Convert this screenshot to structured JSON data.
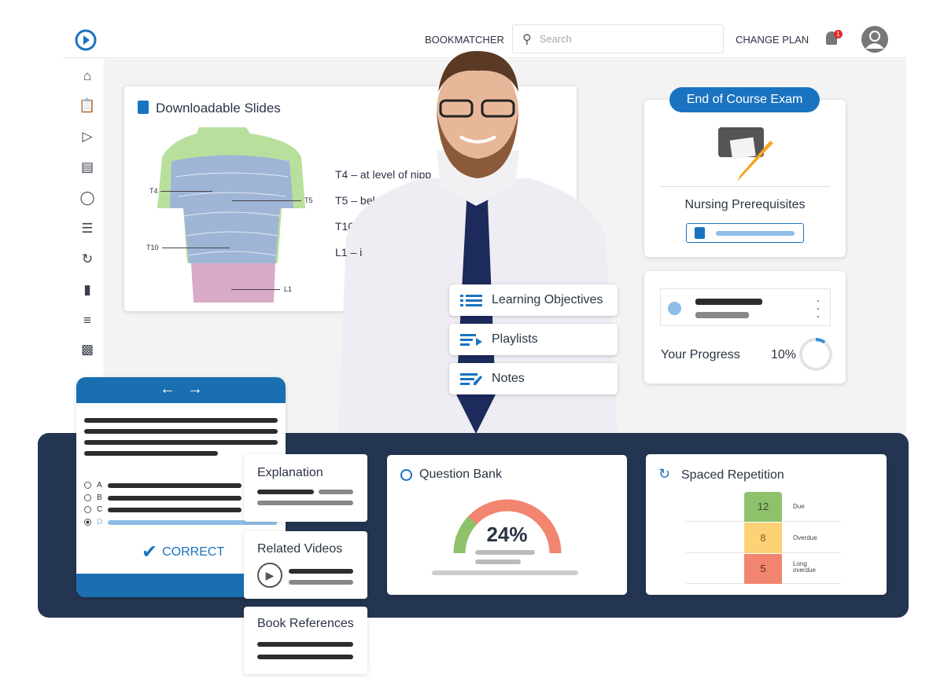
{
  "header": {
    "bookmatcher": "BOOKMATCHER",
    "search_placeholder": "Search",
    "change_plan": "CHANGE PLAN",
    "notification_count": "1"
  },
  "sidebar": {
    "icons": [
      "home-icon",
      "clipboard-icon",
      "video-icon",
      "library-icon",
      "qbank-icon",
      "list-icon",
      "repetition-icon",
      "bookmark-icon",
      "notes-icon",
      "stats-icon"
    ]
  },
  "slides": {
    "title": "Downloadable Slides",
    "labels": [
      "T4",
      "T5",
      "T10",
      "L1"
    ],
    "bullets": [
      "T4 – at level of nipp",
      "T5 – below nip",
      "T10 – u",
      "L1 – i"
    ]
  },
  "exam": {
    "pill": "End of Course Exam",
    "course": "Nursing Prerequisites"
  },
  "progress": {
    "label": "Your Progress",
    "value": "10%",
    "percent": 10
  },
  "menu": {
    "items": [
      "Learning Objectives",
      "Playlists",
      "Notes"
    ]
  },
  "quiz": {
    "options": [
      "A",
      "B",
      "C",
      "D"
    ],
    "selected": "D",
    "result": "CORRECT"
  },
  "panels": {
    "explanation": "Explanation",
    "related_videos": "Related Videos",
    "book_references": "Book References"
  },
  "qbank": {
    "title": "Question Bank",
    "value": "24%",
    "percent": 24
  },
  "spaced": {
    "title": "Spaced Repetition",
    "rows": [
      {
        "count": "12",
        "label": "Due",
        "color": "#8dc26a"
      },
      {
        "count": "8",
        "label": "Overdue",
        "color": "#fdd276"
      },
      {
        "count": "5",
        "label": "Long overdue",
        "color": "#f28570"
      }
    ]
  },
  "colors": {
    "accent": "#1a73c0",
    "dark_band": "#233551"
  }
}
